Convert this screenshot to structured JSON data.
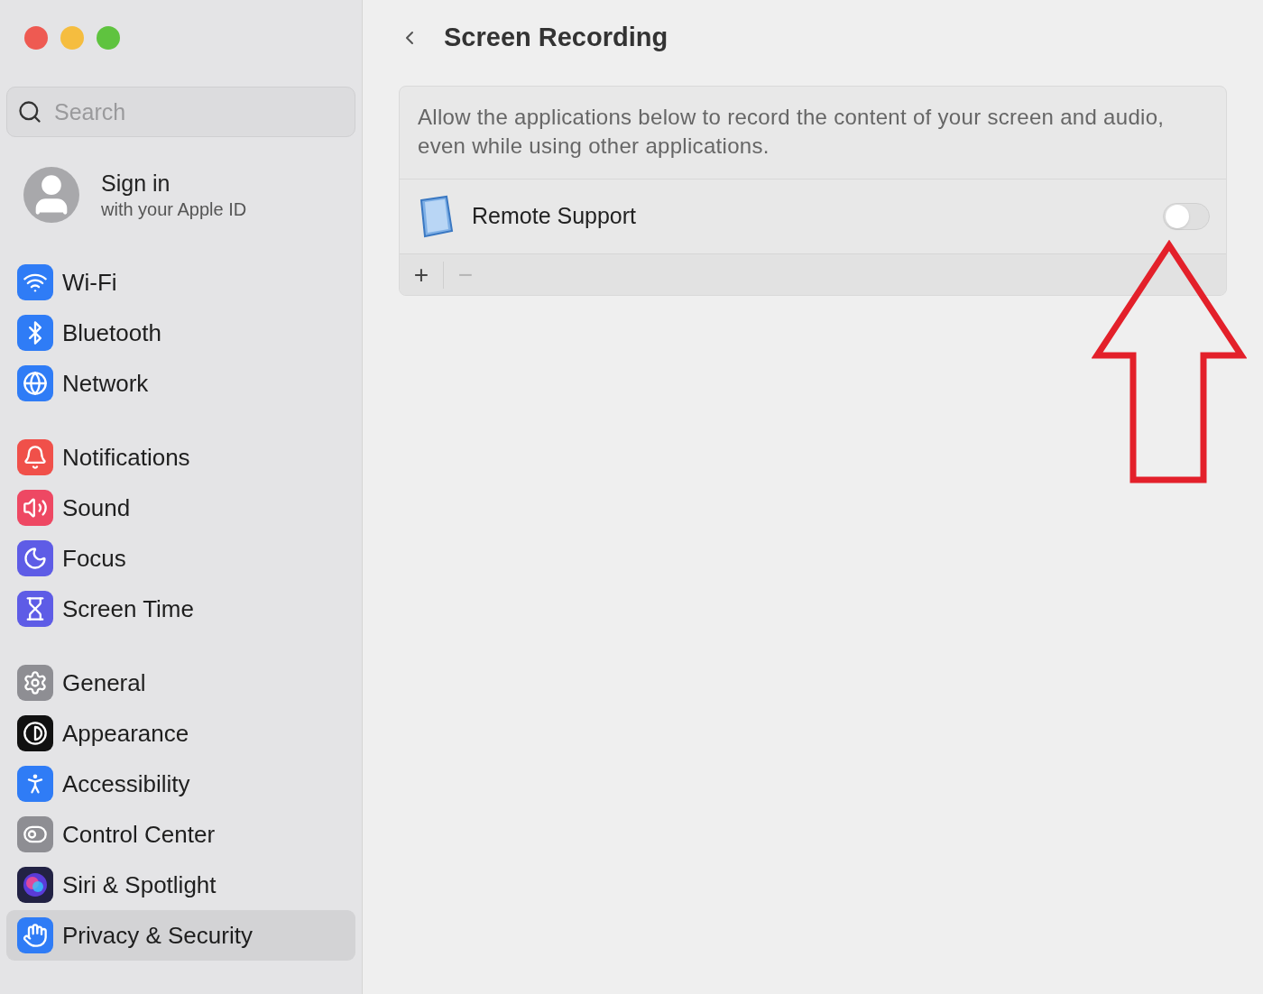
{
  "search": {
    "placeholder": "Search"
  },
  "account": {
    "title": "Sign in",
    "subtitle": "with your Apple ID"
  },
  "sidebar": {
    "groups": [
      {
        "items": [
          {
            "label": "Wi-Fi",
            "selected": false
          },
          {
            "label": "Bluetooth",
            "selected": false
          },
          {
            "label": "Network",
            "selected": false
          }
        ]
      },
      {
        "items": [
          {
            "label": "Notifications",
            "selected": false
          },
          {
            "label": "Sound",
            "selected": false
          },
          {
            "label": "Focus",
            "selected": false
          },
          {
            "label": "Screen Time",
            "selected": false
          }
        ]
      },
      {
        "items": [
          {
            "label": "General",
            "selected": false
          },
          {
            "label": "Appearance",
            "selected": false
          },
          {
            "label": "Accessibility",
            "selected": false
          },
          {
            "label": "Control Center",
            "selected": false
          },
          {
            "label": "Siri & Spotlight",
            "selected": false
          },
          {
            "label": "Privacy & Security",
            "selected": true
          }
        ]
      }
    ]
  },
  "page": {
    "title": "Screen Recording",
    "description": "Allow the applications below to record the content of your screen and audio, even while using other applications."
  },
  "apps": [
    {
      "name": "Remote Support",
      "on": false
    }
  ],
  "list_controls": [
    {
      "label": "+",
      "disabled": false
    },
    {
      "label": "−",
      "disabled": true
    }
  ]
}
